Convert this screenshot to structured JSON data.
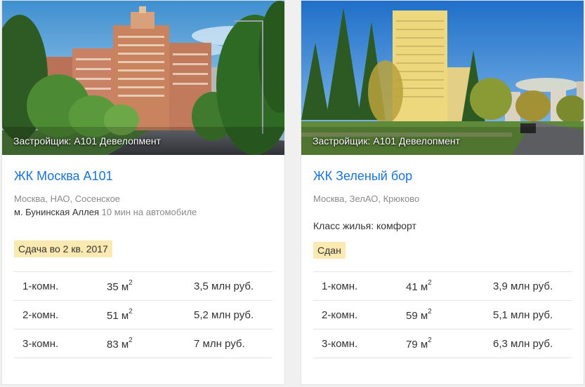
{
  "cards": [
    {
      "developer": "Застройщик: А101 Девелопмент",
      "title": "ЖК Москва А101",
      "location": "Москва, НАО, Сосенское",
      "metro": {
        "station": "м. Бунинская Аллея",
        "time": "10 мин на автомобиле"
      },
      "badge": "Сдача во 2 кв. 2017",
      "offers": [
        {
          "rooms": "1-комн.",
          "area": "35 м",
          "area_sup": "2",
          "price": "3,5 млн руб."
        },
        {
          "rooms": "2-комн.",
          "area": "51 м",
          "area_sup": "2",
          "price": "5,2 млн руб."
        },
        {
          "rooms": "3-комн.",
          "area": "83 м",
          "area_sup": "2",
          "price": "7 млн руб."
        }
      ]
    },
    {
      "developer": "Застройщик: А101 Девелопмент",
      "title": "ЖК Зеленый бор",
      "location": "Москва, ЗелАО, Крюково",
      "housing_class": "Класс жилья: комфорт",
      "badge": "Сдан",
      "offers": [
        {
          "rooms": "1-комн.",
          "area": "41 м",
          "area_sup": "2",
          "price": "3,9 млн руб."
        },
        {
          "rooms": "2-комн.",
          "area": "59 м",
          "area_sup": "2",
          "price": "5,1 млн руб."
        },
        {
          "rooms": "3-комн.",
          "area": "79 м",
          "area_sup": "2",
          "price": "6,3 млн руб."
        }
      ]
    }
  ],
  "colors": {
    "link": "#1a73d8",
    "badge_bg": "#fbe9b2",
    "muted_text": "#8a8a8a"
  }
}
